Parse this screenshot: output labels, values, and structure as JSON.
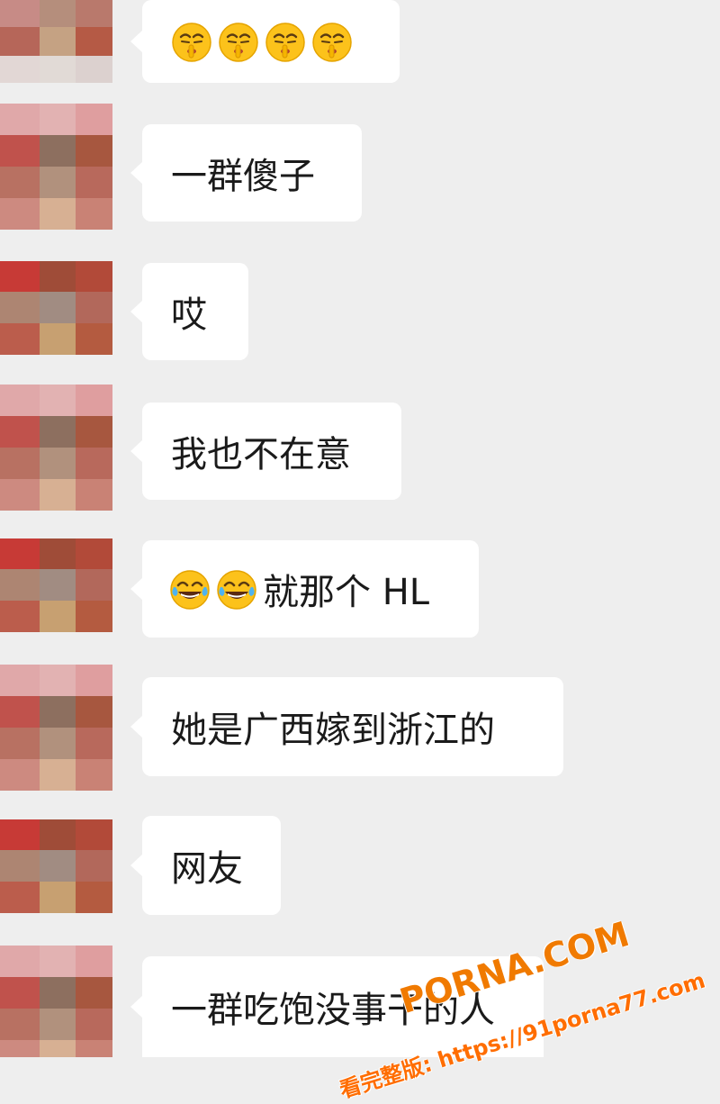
{
  "chat": {
    "messages": [
      {
        "id": "m1",
        "emojis": [
          "shushing-face-icon",
          "shushing-face-icon",
          "shushing-face-icon",
          "shushing-face-icon"
        ],
        "text": ""
      },
      {
        "id": "m2",
        "emojis": [],
        "text": "一群傻子"
      },
      {
        "id": "m3",
        "emojis": [],
        "text": "哎"
      },
      {
        "id": "m4",
        "emojis": [],
        "text": "我也不在意"
      },
      {
        "id": "m5",
        "emojis": [
          "tears-of-joy-icon",
          "tears-of-joy-icon"
        ],
        "text": "就那个 HL"
      },
      {
        "id": "m6",
        "emojis": [],
        "text": "她是广西嫁到浙江的"
      },
      {
        "id": "m7",
        "emojis": [],
        "text": "网友"
      },
      {
        "id": "m8",
        "emojis": [],
        "text": "一群吃饱没事干的人"
      }
    ]
  },
  "watermark": {
    "brand": "PORNA.COM",
    "line": "看完整版: https://91porna77.com"
  },
  "colors": {
    "background": "#eeeeee",
    "bubble": "#ffffff",
    "text": "#1a1a1a",
    "watermark": "#f07a00"
  }
}
